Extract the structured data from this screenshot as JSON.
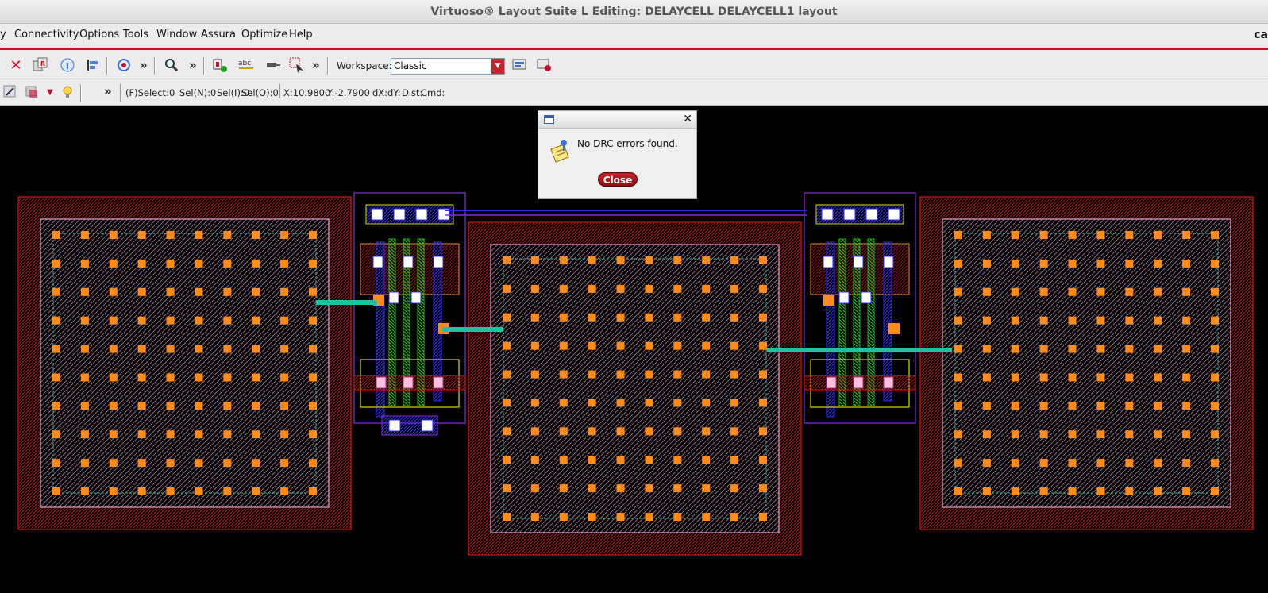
{
  "window": {
    "title": "Virtuoso® Layout Suite L Editing: DELAYCELL DELAYCELL1 layout"
  },
  "menubar": {
    "items": [
      {
        "label": "y"
      },
      {
        "label": "Connectivity"
      },
      {
        "label": "Options"
      },
      {
        "label": "Tools"
      },
      {
        "label": "Window"
      },
      {
        "label": "Assura"
      },
      {
        "label": "Optimize"
      },
      {
        "label": "Help"
      }
    ],
    "brand": "ca"
  },
  "toolbar": {
    "overflow": "»",
    "workspace_label": "Workspace:",
    "workspace_value": "Classic"
  },
  "statusbar": {
    "select": "(F)Select:0",
    "sel_n": "Sel(N):0",
    "sel_i": "Sel(I):0",
    "sel_o": "Sel(O):0",
    "x": "X:10.9800",
    "y": "Y:-2.7900",
    "dx": "dX:",
    "dy": "dY:",
    "dist": "Dist:",
    "cmd": "Cmd:"
  },
  "dialog": {
    "message": "No DRC errors found.",
    "close_label": "Close"
  },
  "colors": {
    "accent": "#c8102e",
    "layout_boundary": "#e01010",
    "pad": "#ff8c1a",
    "metal1": "#2a2aff",
    "poly": "#10c010",
    "nwell": "#8a2be2"
  }
}
